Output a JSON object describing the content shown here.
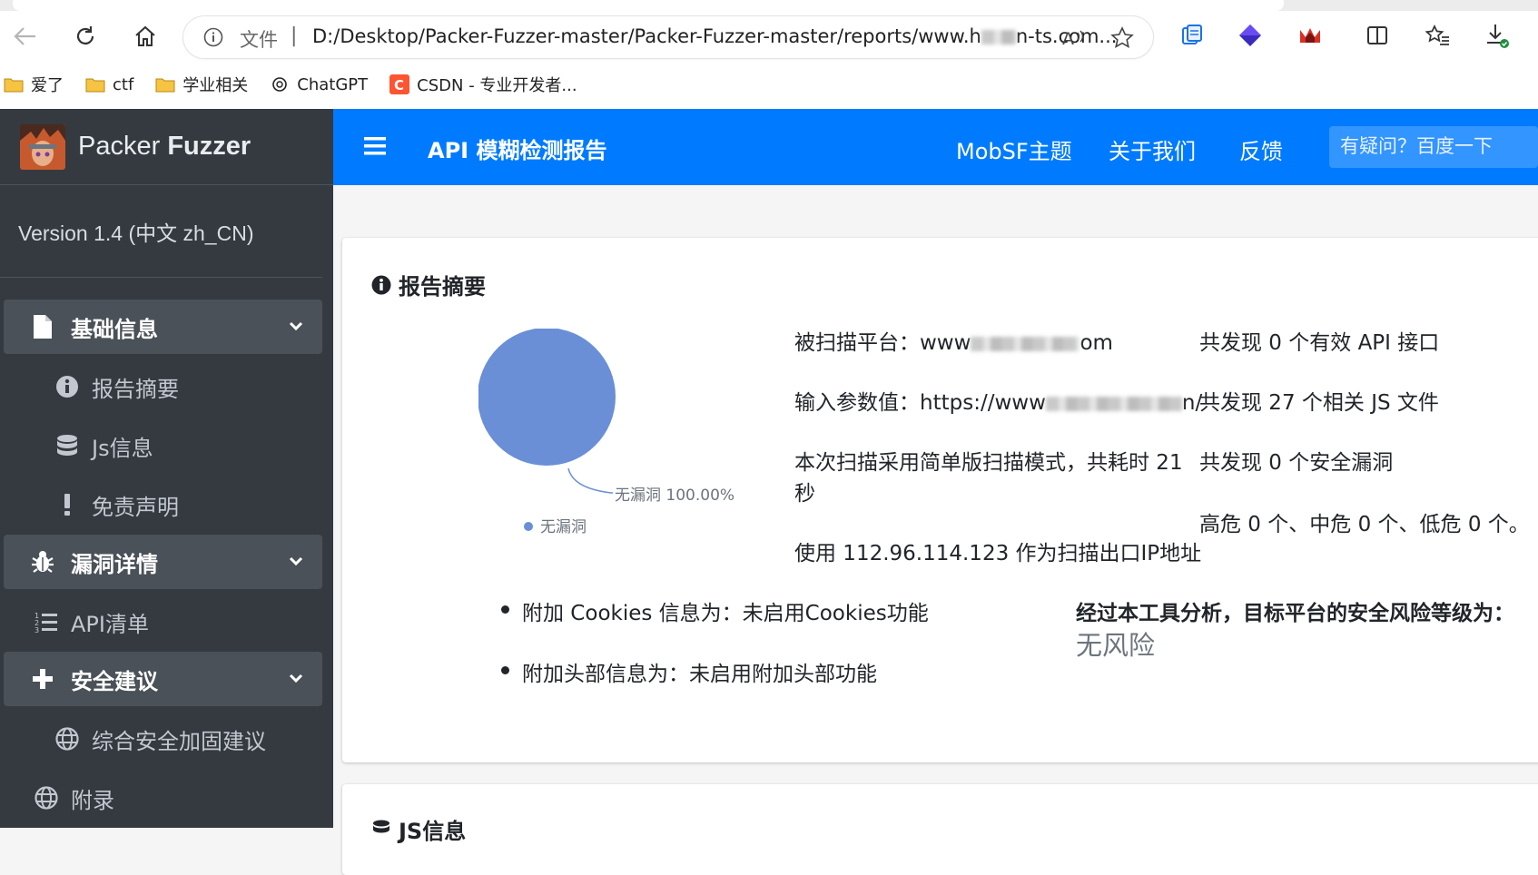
{
  "browser": {
    "address_label": "文件",
    "url": "D:/Desktop/Packer-Fuzzer-master/Packer-Fuzzer-master/reports/www.h",
    "url_tail": "n-ts.com...",
    "bookmarks": [
      {
        "label": "爱了",
        "icon": "folder-icon"
      },
      {
        "label": "ctf",
        "icon": "folder-icon"
      },
      {
        "label": "学业相关",
        "icon": "folder-icon"
      },
      {
        "label": "ChatGPT",
        "icon": "openai-icon"
      },
      {
        "label": "CSDN - 专业开发者...",
        "icon": "csdn-icon"
      }
    ]
  },
  "sidebar": {
    "brand_light": "Packer ",
    "brand_bold": "Fuzzer",
    "version": "Version 1.4 (中文 zh_CN)",
    "groups": [
      {
        "label": "基础信息",
        "items": [
          "报告摘要",
          "Js信息",
          "免责声明"
        ]
      },
      {
        "label": "漏洞详情"
      },
      {
        "label": "安全建议",
        "items": [
          "综合安全加固建议"
        ]
      }
    ],
    "api_list": "API清单",
    "appendix": "附录"
  },
  "topbar": {
    "title": "API 模糊检测报告",
    "links": [
      "MobSF主题",
      "关于我们",
      "反馈"
    ],
    "search_placeholder": "有疑问？百度一下"
  },
  "summary": {
    "title": "报告摘要",
    "platform_label": "被扫描平台：",
    "platform_value_start": "www",
    "platform_value_end": "om",
    "param_label": "输入参数值：",
    "param_value_start": "https://www",
    "param_value_end": "n/",
    "scan_mode_line1": "本次扫描采用简单版扫描模式，共耗时 21",
    "scan_mode_line2": "秒",
    "ip_text": "使用 112.96.114.123 作为扫描出口IP地址",
    "api_found": "共发现 0 个有效 API 接口",
    "js_found": "共发现 27 个相关 JS 文件",
    "vuln_found": "共发现 0 个安全漏洞",
    "severity": "高危 0 个、中危 0 个、低危 0 个。",
    "cookies": "附加 Cookies 信息为：未启用Cookies功能",
    "headers": "附加头部信息为：未启用附加头部功能",
    "risk_label": "经过本工具分析，目标平台的安全风险等级为：",
    "risk_value": "无风险"
  },
  "chart_data": {
    "type": "pie",
    "categories": [
      "无漏洞"
    ],
    "values": [
      100
    ],
    "slice_labels": [
      "无漏洞 100.00%"
    ],
    "legend": [
      "无漏洞"
    ],
    "legend_position": "bottom",
    "colors": [
      "#6a8fd6"
    ]
  },
  "js_section": {
    "title": "JS信息"
  }
}
